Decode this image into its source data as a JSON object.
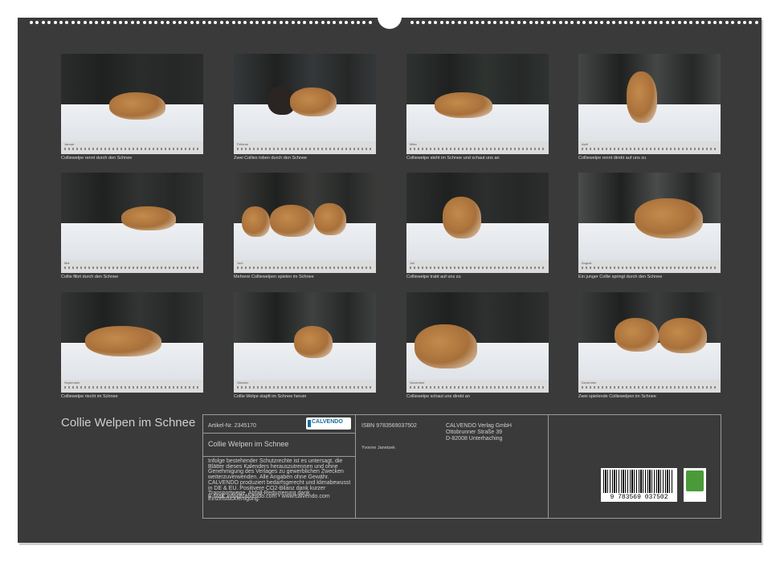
{
  "calendar": {
    "title": "Collie Welpen im Schnee",
    "months": [
      {
        "month": "Januar",
        "caption": "Colliewelpe rennt durch den Schnee"
      },
      {
        "month": "Februar",
        "caption": "Zwei Collies toben durch den Schnee"
      },
      {
        "month": "März",
        "caption": "Colliewelpe steht im Schnee und schaut uns an"
      },
      {
        "month": "April",
        "caption": "Colliewelpe rennt direkt auf uns zu"
      },
      {
        "month": "Mai",
        "caption": "Collie flitzt durch den Schnee"
      },
      {
        "month": "Juni",
        "caption": "Mehrere Colliewelpen spielen im Schnee"
      },
      {
        "month": "Juli",
        "caption": "Colliewelpe trabt auf uns zu"
      },
      {
        "month": "August",
        "caption": "Ein junger Collie springt durch den Schnee"
      },
      {
        "month": "September",
        "caption": "Colliewelpe riecht im Schnee"
      },
      {
        "month": "Oktober",
        "caption": "Collie Welpe stapft im Schnee herum"
      },
      {
        "month": "November",
        "caption": "Colliewelpe schaut uns direkt an"
      },
      {
        "month": "Dezember",
        "caption": "Zwei spielende Colliewelpen im Schnee"
      }
    ]
  },
  "info": {
    "article": "Artikel-Nr. 2345170",
    "logo": "CALVENDO",
    "product_title": "Collie Welpen im Schnee",
    "legal": "Infolge bestehender Schutzrechte ist es untersagt, die Blätter dieses Kalenders herauszutrennen und ohne Genehmigung des Verlages zu gewerblichen Zwecken weiterzuverwenden. Alle Angaben ohne Gewähr. CALVENDO produziert bedarfsgerecht und klimabewusst in DE & EU. Positivere CO2-Bilanz dank kurzer Transportwege. Abfall-Reduzierung dank Einzelstückfertigung.",
    "contact": "E-Mail: info@calvendo.com • www.calvendo.com",
    "isbn": "ISBN 9783569037502",
    "author": "Yvonne Janetzek",
    "publisher": "CALVENDO Verlag GmbH",
    "street": "Ottobrunner Straße 39",
    "city": "D-82008 Unterhaching",
    "barcode_number": "9 783569 037502",
    "eco_label": "eco"
  }
}
